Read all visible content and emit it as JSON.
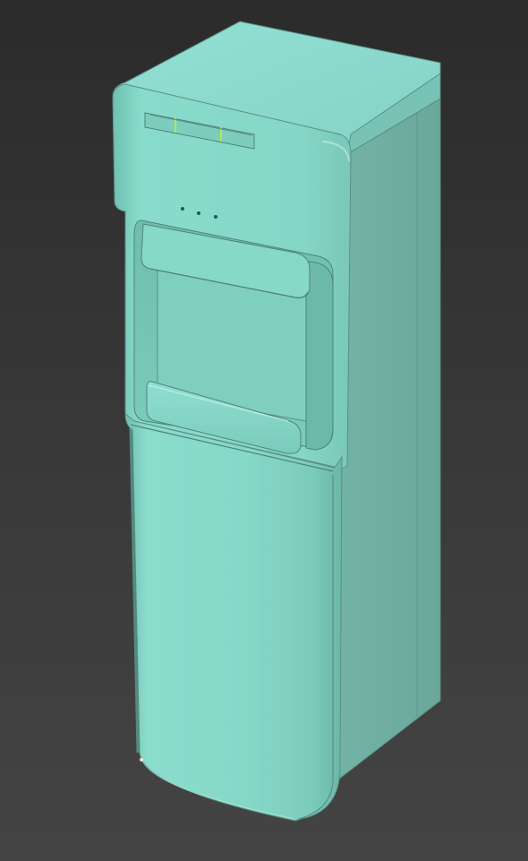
{
  "scene": {
    "viewport": {
      "background_top": "#2b2b2b",
      "background_bottom": "#444444"
    },
    "object": {
      "kind": "water-cooler-3d-model",
      "colors": {
        "front_light": "#8adccd",
        "front_mid": "#7dd0c0",
        "front_dark": "#6cb9aa",
        "side": "#6faea0",
        "side_dark": "#5f9a8d",
        "top": "#8edad0",
        "edge": "#5a8f84",
        "indicator": "#1d5a4f",
        "highlight": "#c9f0e8"
      },
      "indicator_lights_count": 3,
      "top_vent_slots_count": 3
    }
  }
}
